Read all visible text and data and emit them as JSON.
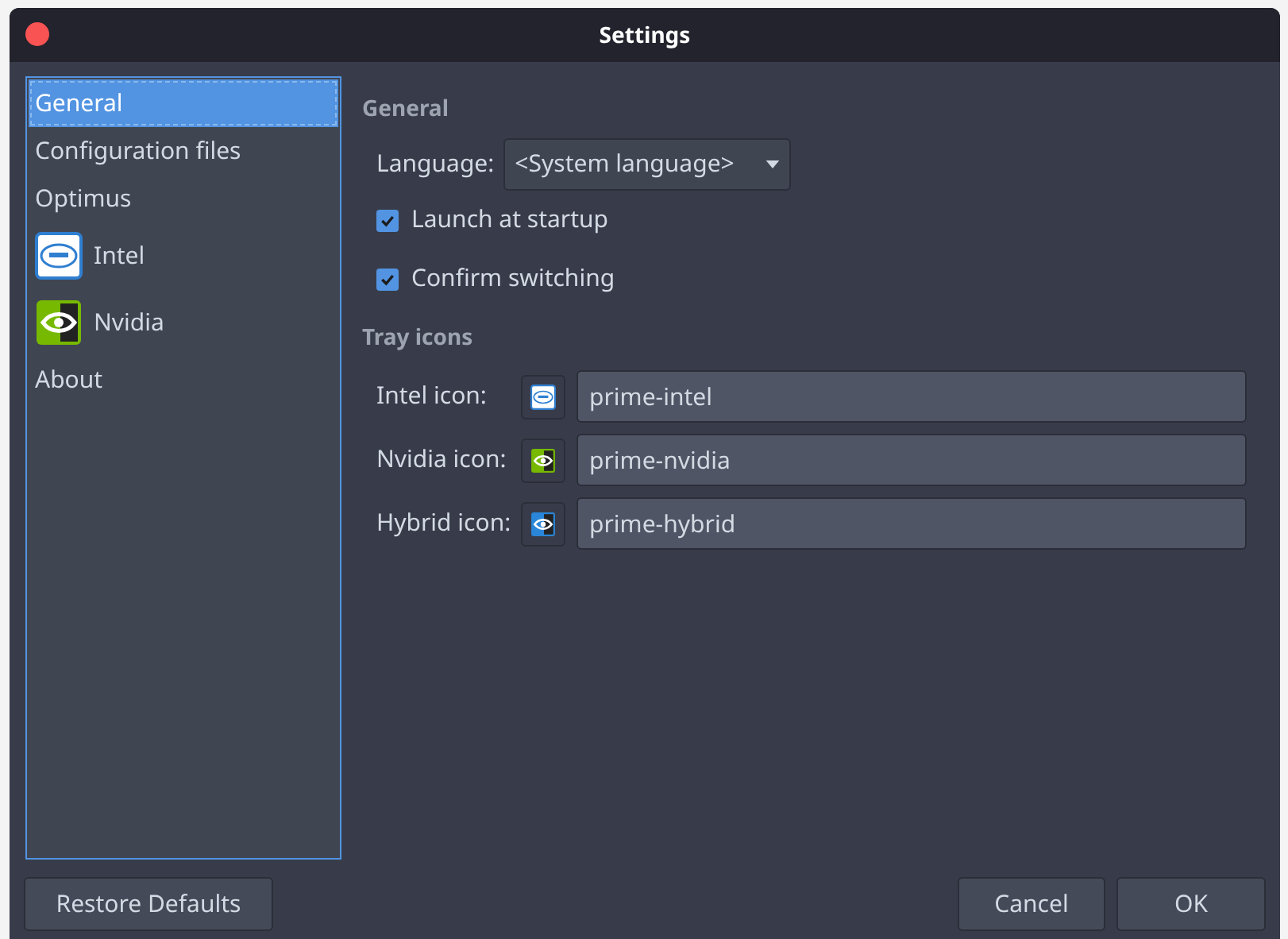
{
  "window": {
    "title": "Settings"
  },
  "sidebar": {
    "items": [
      {
        "label": "General",
        "kind": "plain",
        "selected": true
      },
      {
        "label": "Configuration files",
        "kind": "plain",
        "selected": false
      },
      {
        "label": "Optimus",
        "kind": "plain",
        "selected": false
      },
      {
        "label": "Intel",
        "kind": "intel",
        "selected": false
      },
      {
        "label": "Nvidia",
        "kind": "nvidia",
        "selected": false
      },
      {
        "label": "About",
        "kind": "plain",
        "selected": false
      }
    ]
  },
  "general": {
    "heading": "General",
    "language": {
      "label": "Language:",
      "value": "<System language>"
    },
    "checkboxes": [
      {
        "label": "Launch at startup",
        "checked": true
      },
      {
        "label": "Confirm switching",
        "checked": true
      }
    ]
  },
  "tray_icons": {
    "heading": "Tray icons",
    "rows": [
      {
        "label": "Intel icon:",
        "kind": "intel",
        "value": "prime-intel"
      },
      {
        "label": "Nvidia icon:",
        "kind": "nvidia",
        "value": "prime-nvidia"
      },
      {
        "label": "Hybrid icon:",
        "kind": "hybrid",
        "value": "prime-hybrid"
      }
    ]
  },
  "buttons": {
    "restore": "Restore Defaults",
    "cancel": "Cancel",
    "ok": "OK"
  }
}
